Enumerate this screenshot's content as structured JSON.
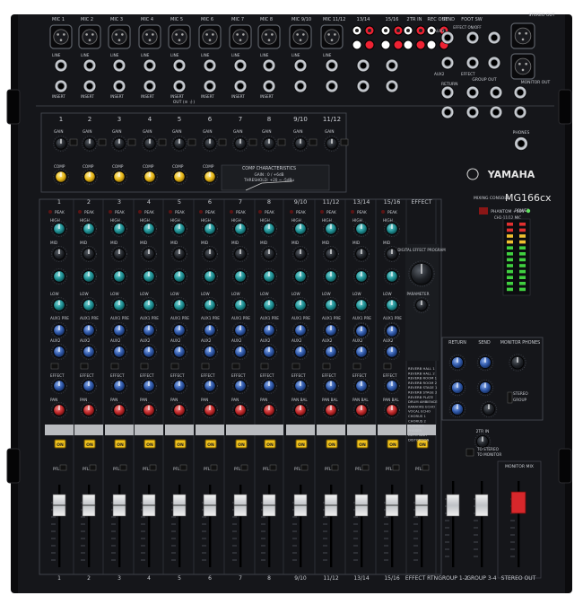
{
  "input_labels": [
    "MIC 1",
    "MIC 2",
    "MIC 3",
    "MIC 4",
    "MIC 5",
    "MIC 6",
    "MIC 7",
    "MIC 8",
    "MIC 9/10",
    "MIC 11/12"
  ],
  "line_label": "LINE",
  "insert_label": "INSERT",
  "stereo_top_labels": [
    "13/14",
    "15/16",
    "2TR IN",
    "REC OUT"
  ],
  "send_label": "SEND",
  "foot_sw_label": "FOOT SW",
  "effect_onoff_label": "EFFECT ON/OFF",
  "stereo_out_label": "STEREO OUT",
  "aux_labels": [
    "AUX1",
    "AUX2",
    "EFFECT"
  ],
  "return_label": "RETURN",
  "group_out_label": "GROUP OUT",
  "monitor_out_label": "MONITOR OUT",
  "phones_label": "PHONES",
  "out_label": "OUT (≡ ⏚)",
  "channel_numbers_top": [
    "1",
    "2",
    "3",
    "4",
    "5",
    "6",
    "7",
    "8",
    "9/10",
    "11/12"
  ],
  "gain_label": "GAIN",
  "comp_label": "COMP",
  "comp_char_title": "COMP CHARACTERISTICS",
  "comp_char_lines": [
    "GAIN : 0 / +6dB",
    "THRESHOLD: +20 ~ -5dBu"
  ],
  "brand": "YAMAHA",
  "model_prefix": "MIXING CONSOLE",
  "model": "MG166cx",
  "phantom_label": "PHANTOM +48V",
  "phantom_sub": "CH1-11/12 MIC",
  "power_label": "POWER",
  "strip_headers": [
    "1",
    "2",
    "3",
    "4",
    "5",
    "6",
    "7",
    "8",
    "9/10",
    "11/12",
    "13/14",
    "15/16",
    "EFFECT"
  ],
  "peak_label": "PEAK",
  "eq_labels": [
    "HIGH",
    "MID",
    "LOW"
  ],
  "aux_pre_label": "AUX1 PRE",
  "aux2_label": "AUX2",
  "effect_label": "EFFECT",
  "pan_label": "PAN",
  "bal_label": "PAN BAL",
  "on_label": "ON",
  "pfl_label": "PFL",
  "dep_title": "DIGITAL EFFECT PROGRAM",
  "parameter_label": "PARAMETER",
  "effect_programs": [
    "REVERB HALL 1",
    "REVERB HALL 2",
    "REVERB ROOM 1",
    "REVERB ROOM 2",
    "REVERB STAGE 1",
    "REVERB STAGE 2",
    "REVERB PLATE",
    "DRUM AMBIENCE",
    "KARAOKE ECHO",
    "VOCAL ECHO",
    "CHORUS 1",
    "CHORUS 2",
    "FLANGER",
    "PHASER",
    "AUTO WAH",
    "DISTORTION"
  ],
  "master_section_labels": [
    "RETURN",
    "SEND",
    "MONITOR PHONES"
  ],
  "stereo_label": "STEREO",
  "group_label": "GROUP",
  "to_stereo_label": "TO STEREO",
  "to_monitor_label": "TO MONITOR",
  "twotr_in_label": "2TR IN",
  "monitor_mix_label": "MONITOR MIX",
  "bottom_labels": [
    "1",
    "2",
    "3",
    "4",
    "5",
    "6",
    "7",
    "8",
    "9/10",
    "11/12",
    "13/14",
    "15/16",
    "EFFECT RTN",
    "GROUP 1-2",
    "GROUP 3-4",
    "STEREO OUT"
  ],
  "colors": {
    "panel": "#15161a",
    "frame": "#0b0b0d",
    "label": "#c9ccd2",
    "knob_dark": "#23262c",
    "knob_teal": "#1e8f93",
    "knob_blue": "#2e57a8",
    "knob_red": "#c0282a",
    "knob_yellow": "#e8b818",
    "on_button": "#f1c21b",
    "fader_red": "#d8272b"
  }
}
